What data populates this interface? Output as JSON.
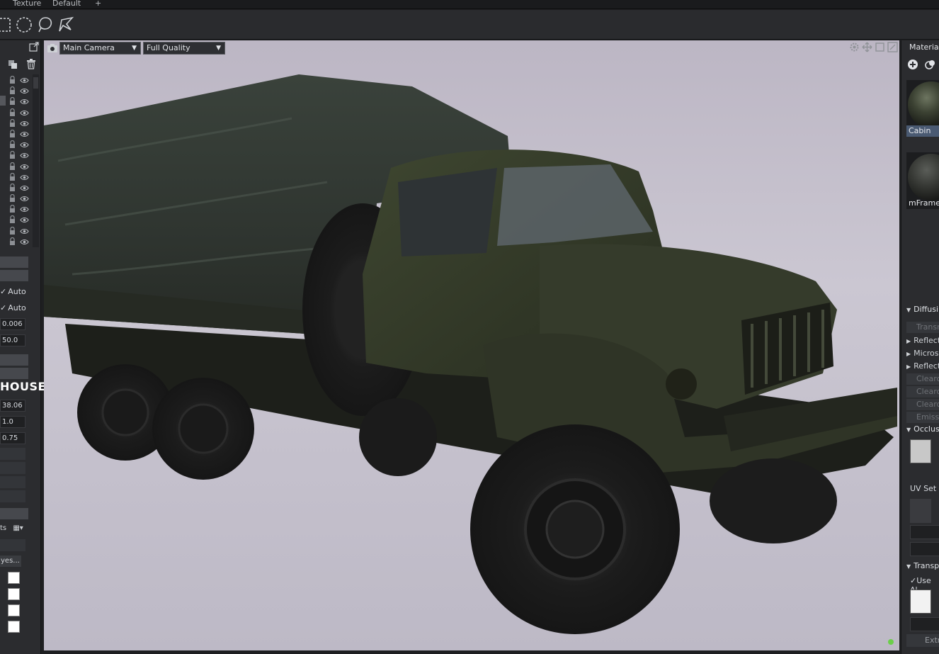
{
  "tabs": [
    "Texture",
    "Default",
    "+"
  ],
  "toolbar": {
    "tools": [
      "rect-select",
      "ellipse-select",
      "lasso-select",
      "polygon-select"
    ]
  },
  "viewport": {
    "camera": "Main Camera",
    "quality": "Full Quality",
    "subject": "military-truck-render"
  },
  "left_panel": {
    "layer_rows": 16,
    "auto_1": "Auto",
    "auto_2": "Auto",
    "field_1": "0.006",
    "field_2": "50.0",
    "title": "HOUSE",
    "field_3": "38.06",
    "field_4": "1.0",
    "field_5": "0.75",
    "select_label": "ts",
    "button_label": "yes..."
  },
  "right_panel": {
    "title": "Materials",
    "materials": [
      {
        "label": "Cabin",
        "selected": true
      },
      {
        "label": "mFrame",
        "selected": false
      }
    ],
    "sections": {
      "diffuse": "Diffusi",
      "transm": "Transm",
      "reflect1": "Reflect",
      "micros": "Micros",
      "reflect2": "Reflect",
      "clear1": "Clearc",
      "clear2": "Clearc",
      "clear3": "Clearc",
      "emissi": "Emissi",
      "occlus": "Occlus",
      "uvset": "UV Set",
      "transp": "Transp",
      "use_al": "Use Al",
      "extra": "Extra:"
    }
  },
  "colors": {
    "accent": "#4a5a72",
    "status": "#6bcf4a",
    "panel": "#2b2c2f"
  }
}
